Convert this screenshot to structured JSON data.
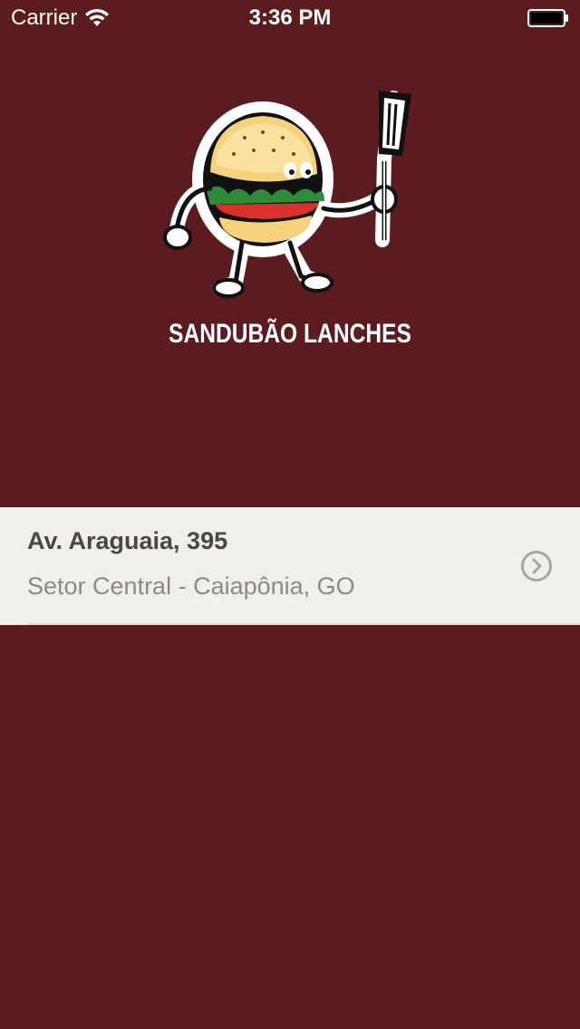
{
  "status_bar": {
    "carrier": "Carrier",
    "time": "3:36 PM",
    "wifi_icon": "wifi-icon",
    "battery_icon": "battery-icon"
  },
  "brand": {
    "logo_icon": "burger-mascot-logo",
    "name": "SANDUBÃO LANCHES"
  },
  "location": {
    "street": "Av. Araguaia, 395",
    "city": "Setor Central - Caiapônia, GO",
    "chevron_icon": "chevron-right-circle-icon"
  },
  "colors": {
    "background": "#5c1b1e",
    "cell_background": "#f0efeb",
    "street_text": "#4a4644",
    "city_text": "#8d8a86"
  }
}
